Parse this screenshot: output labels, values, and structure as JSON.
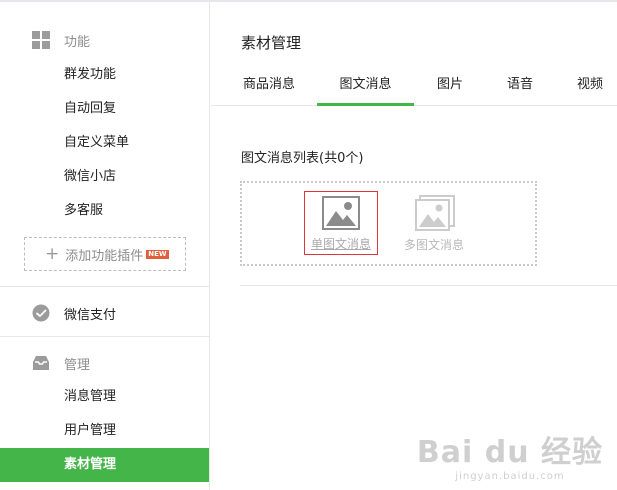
{
  "sidebar": {
    "section_function": {
      "label": "功能",
      "icon": "grid-icon"
    },
    "function_items": [
      "群发功能",
      "自动回复",
      "自定义菜单",
      "微信小店",
      "多客服"
    ],
    "add_plugin": {
      "label": "添加功能插件",
      "badge": "NEW"
    },
    "section_pay": {
      "label": "微信支付",
      "icon": "wechat-pay-icon"
    },
    "section_manage": {
      "label": "管理",
      "icon": "inbox-icon"
    },
    "manage_items": [
      "消息管理",
      "用户管理",
      "素材管理"
    ],
    "active_item": "素材管理"
  },
  "main": {
    "title": "素材管理",
    "tabs": [
      "商品消息",
      "图文消息",
      "图片",
      "语音",
      "视频"
    ],
    "active_tab": "图文消息",
    "list_title": "图文消息列表(共0个)",
    "options": [
      {
        "label": "单图文消息",
        "icon": "single-image-icon",
        "selected": true
      },
      {
        "label": "多图文消息",
        "icon": "multi-image-icon",
        "selected": false
      }
    ]
  },
  "watermark": {
    "top": "Bai du 经验",
    "bottom": "jingyan.baidu.com"
  },
  "colors": {
    "accent": "#44b549",
    "select_border": "#d9363e",
    "muted": "#8d8d8d",
    "border": "#e7e7eb"
  }
}
